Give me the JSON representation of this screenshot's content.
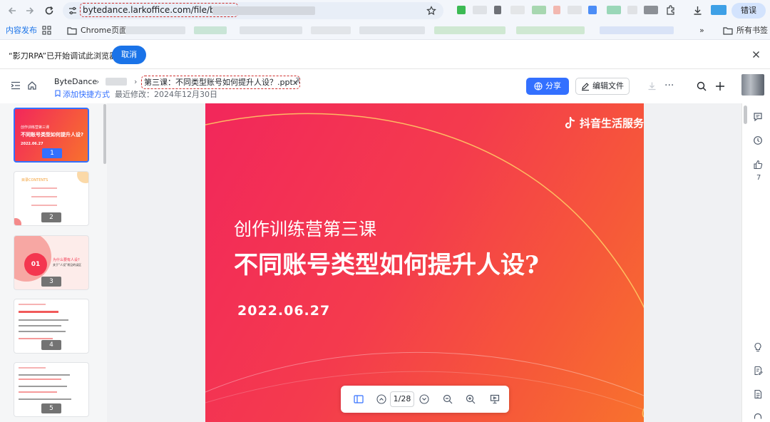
{
  "browser": {
    "url": "bytedance.larkoffice.com/file/boxcn",
    "error_label": "错误",
    "colors": {
      "accent": "#1a73e8",
      "highlight": "#d0302f"
    }
  },
  "bookmarks": {
    "first": "内容发布",
    "chrome_page": "Chrome页面",
    "all_bookmarks": "所有书签"
  },
  "banner": {
    "text": "“影刀RPA”已开始调试此浏览器",
    "cancel_label": "取消"
  },
  "doc": {
    "breadcrumb_root": "ByteDance",
    "title": "第三课：不同类型账号如何提升人设？.pptx",
    "add_shortcut": "添加快捷方式",
    "last_modified": "最近修改：2024年12月30日",
    "share_label": "分享",
    "edit_label": "编辑文件",
    "like_count": "7"
  },
  "slide": {
    "brand": "抖音生活服务",
    "subtitle": "创作训练营第三课",
    "title": "不同账号类型如何提升人设?",
    "date": "2022.06.27",
    "colors": {
      "start": "#f2275b",
      "end": "#f8722d"
    }
  },
  "thumbnails": [
    {
      "num": "1",
      "line1": "创作训练营第三课",
      "line2": "不同账号类型如何提升人设?",
      "date": "2022.06.27"
    },
    {
      "num": "2",
      "heading": "目录CONTENTS"
    },
    {
      "num": "3",
      "badge": "01",
      "heading": "为什么要有人设?",
      "sub": "关于“人设”常见的误区"
    },
    {
      "num": "4"
    },
    {
      "num": "5"
    }
  ],
  "toolbar": {
    "page_indicator": "1/28"
  }
}
